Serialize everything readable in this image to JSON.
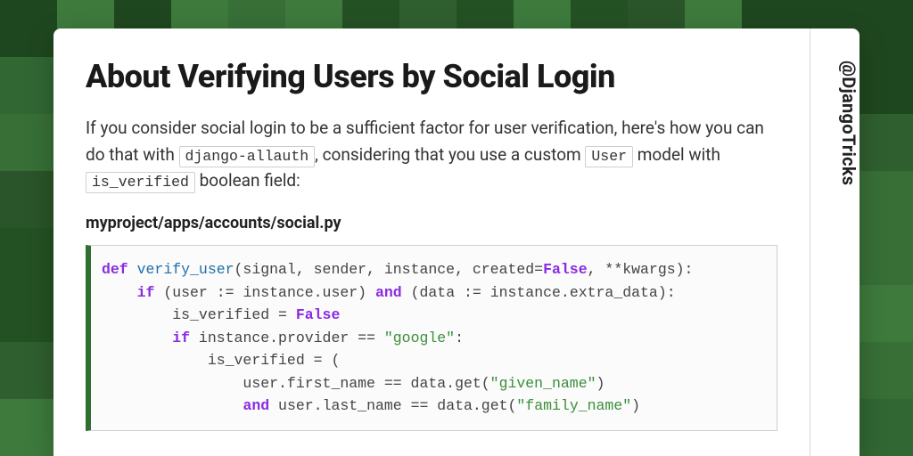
{
  "colors": {
    "bg_shades": [
      "#2f5f2f",
      "#316733",
      "#2a5429",
      "#376f37",
      "#245124",
      "#3d7a3c",
      "#1f471f"
    ],
    "code_border_accent": "#2f6f2f"
  },
  "handle": "@DjangoTricks",
  "title": "About Verifying Users by Social Login",
  "lead": {
    "part1": "If you consider social login to be a sufficient factor for user verification, here's how you can do that with ",
    "code1": "django-allauth",
    "part2": ", considering that you use a custom ",
    "code2": "User",
    "part3": " model with ",
    "code3": "is_verified",
    "part4": " boolean field:"
  },
  "filepath": "myproject/apps/accounts/social.py",
  "code": {
    "tokens": [
      [
        [
          "kw",
          "def "
        ],
        [
          "fn",
          "verify_user"
        ],
        [
          "",
          "(signal, sender, instance, created="
        ],
        [
          "bool",
          "False"
        ],
        [
          "",
          ", **kwargs):"
        ]
      ],
      [
        [
          "",
          "    "
        ],
        [
          "kw",
          "if"
        ],
        [
          "",
          " (user := instance.user) "
        ],
        [
          "kw",
          "and"
        ],
        [
          "",
          " (data := instance.extra_data):"
        ]
      ],
      [
        [
          "",
          "        is_verified = "
        ],
        [
          "bool",
          "False"
        ]
      ],
      [
        [
          "",
          "        "
        ],
        [
          "kw",
          "if"
        ],
        [
          "",
          " instance.provider == "
        ],
        [
          "str",
          "\"google\""
        ],
        [
          "",
          ":"
        ]
      ],
      [
        [
          "",
          "            is_verified = ("
        ]
      ],
      [
        [
          "",
          "                user.first_name == data.get("
        ],
        [
          "str",
          "\"given_name\""
        ],
        [
          "",
          ")"
        ]
      ],
      [
        [
          "",
          "                "
        ],
        [
          "kw",
          "and"
        ],
        [
          "",
          " user.last_name == data.get("
        ],
        [
          "str",
          "\"family_name\""
        ],
        [
          "",
          ")"
        ]
      ]
    ]
  }
}
